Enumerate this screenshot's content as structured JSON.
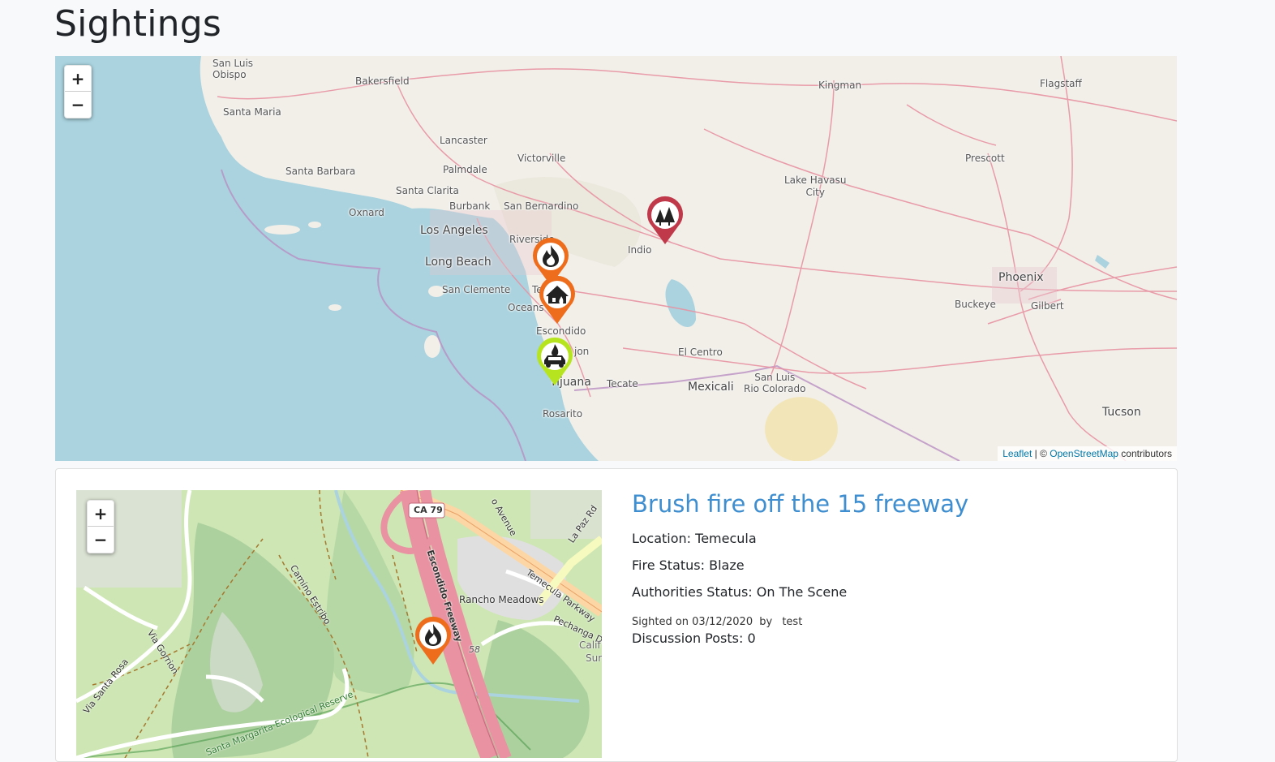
{
  "page": {
    "title": "Sightings"
  },
  "main_map": {
    "zoom_in": "+",
    "zoom_out": "−",
    "places": {
      "san_luis_obispo": "San Luis\nObispo",
      "bakersfield": "Bakersfield",
      "santa_maria": "Santa Maria",
      "lancaster": "Lancaster",
      "palmdale": "Palmdale",
      "victorville": "Victorville",
      "santa_barbara": "Santa Barbara",
      "santa_clarita": "Santa Clarita",
      "oxnard": "Oxnard",
      "burbank": "Burbank",
      "san_bernardino": "San Bernardino",
      "los_angeles": "Los Angeles",
      "riverside": "Riverside",
      "long_beach": "Long Beach",
      "san_clemente": "San Clemente",
      "oceanside": "Oceans",
      "escondido": "Escondido",
      "el_cajon": "jon",
      "tijuana": "Tijuana",
      "tecate": "Tecate",
      "rosarito": "Rosarito",
      "indio": "Indio",
      "el_centro": "El Centro",
      "mexicali": "Mexicali",
      "san_luis_rio_colorado": "San Luis\nRio Colorado",
      "kingman": "Kingman",
      "flagstaff": "Flagstaff",
      "prescott": "Prescott",
      "lake_havasu_city": "Lake Havasu\nCity",
      "phoenix": "Phoenix",
      "buckeye": "Buckeye",
      "gilbert": "Gilbert",
      "tucson": "Tucson",
      "temecula_partial": "Te"
    },
    "attribution": {
      "leaflet": "Leaflet",
      "separator": " | © ",
      "osm": "OpenStreetMap",
      "suffix": " contributors"
    },
    "markers": [
      {
        "name": "marker-wildfire",
        "color": "#c0394b",
        "icon": "forest-fire-icon"
      },
      {
        "name": "marker-brush-fire",
        "color": "#ee6d1d",
        "icon": "flame-icon"
      },
      {
        "name": "marker-structure-fire",
        "color": "#ee6d1d",
        "icon": "house-fire-icon"
      },
      {
        "name": "marker-vehicle-fire",
        "color": "#b6e51f",
        "icon": "car-fire-icon"
      }
    ]
  },
  "sighting": {
    "title": "Brush fire off the 15 freeway",
    "location": "Location: Temecula",
    "fire_status": "Fire Status: Blaze",
    "authorities_status": "Authorities Status: On The Scene",
    "sighted_on": "Sighted on 03/12/2020",
    "by": "by",
    "user": "test",
    "discussion_posts": "Discussion Posts: 0",
    "map": {
      "zoom_in": "+",
      "zoom_out": "−",
      "streets": {
        "ca79": "CA 79",
        "avenue": "o Avenue",
        "la_paz": "La Paz Rd",
        "temecula_parkway": "Temecula Parkway",
        "escondido_freeway": "Escondido Freeway",
        "camino_estribo": "Camino Estribo",
        "via_gorrion": "Via Gorrion",
        "via_santa_rosa": "Via Santa Rosa",
        "rancho_meadows": "Rancho Meadows",
        "pechanga": "Pechanga Dr",
        "calif": "Calif",
        "sur": "Sur",
        "route_58": "58",
        "reserve": "Santa Margarita Ecological Reserve"
      }
    }
  }
}
